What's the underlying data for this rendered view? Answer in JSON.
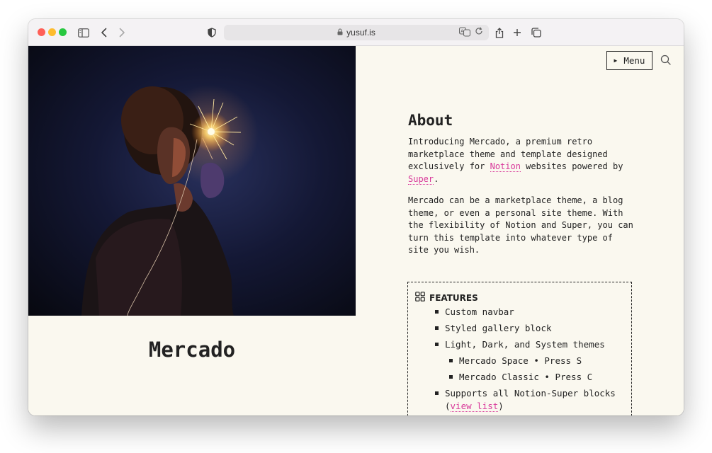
{
  "browser": {
    "url": "yusuf.is"
  },
  "site": {
    "title": "Mercado",
    "menu_label": "Menu"
  },
  "about": {
    "heading": "About",
    "p1_before": "Introducing Mercado, a premium retro marketplace theme and template designed exclusively for ",
    "p1_link1": "Notion",
    "p1_mid": " websites powered by ",
    "p1_link2": "Super",
    "p1_after": ".",
    "p2": "Mercado can be a marketplace theme, a blog theme, or even a personal site theme. With the flexibility of Notion and Super, you can turn this template into whatever type of site you wish."
  },
  "features": {
    "heading": "FEATURES",
    "items": [
      "Custom navbar",
      "Styled gallery block",
      "Light, Dark, and System themes",
      "Mercado Space • Press S",
      "Mercado Classic • Press C",
      "Supports all Notion-Super blocks"
    ],
    "last_paren_open": "(",
    "last_link": "view list",
    "last_paren_close": ")"
  },
  "colors": {
    "accent": "#d8389a",
    "background": "#faf8ef",
    "text": "#222222"
  }
}
